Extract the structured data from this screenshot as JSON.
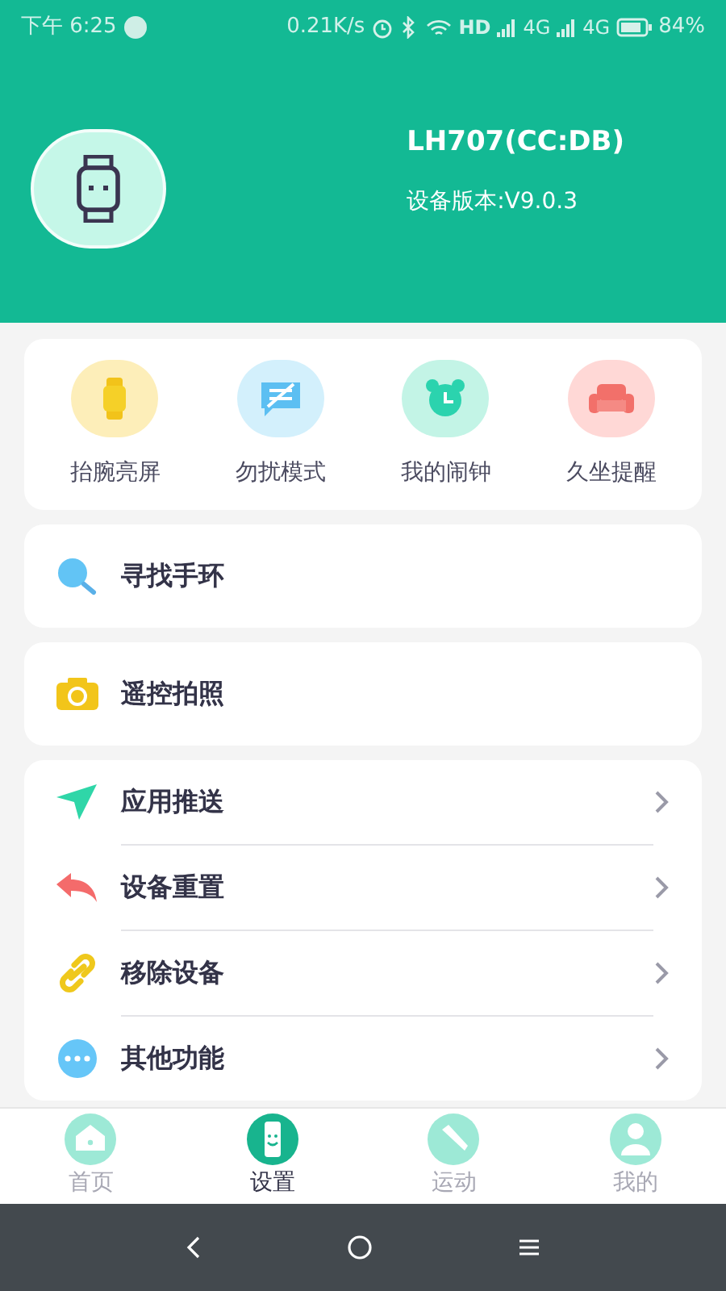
{
  "status_bar": {
    "time": "下午 6:25",
    "speed": "0.21K/s",
    "hd": "HD",
    "network_1": "4G",
    "network_2": "4G",
    "battery": "84%"
  },
  "device": {
    "name": "LH707(CC:DB)",
    "version": "设备版本:V9.0.3"
  },
  "quick_actions": [
    {
      "kind": "wrist",
      "label": "抬腕亮屏"
    },
    {
      "kind": "dnd",
      "label": "勿扰模式"
    },
    {
      "kind": "alarm",
      "label": "我的闹钟"
    },
    {
      "kind": "sedentary",
      "label": "久坐提醒"
    }
  ],
  "single_cards": [
    {
      "kind": "find",
      "label": "寻找手环"
    },
    {
      "kind": "camera",
      "label": "遥控拍照"
    }
  ],
  "menu": [
    {
      "kind": "push",
      "label": "应用推送"
    },
    {
      "kind": "reset",
      "label": "设备重置"
    },
    {
      "kind": "remove",
      "label": "移除设备"
    },
    {
      "kind": "more",
      "label": "其他功能"
    }
  ],
  "tabs": [
    {
      "kind": "home",
      "label": "首页",
      "selected": false
    },
    {
      "kind": "settings",
      "label": "设置",
      "selected": true
    },
    {
      "kind": "sport",
      "label": "运动",
      "selected": false
    },
    {
      "kind": "me",
      "label": "我的",
      "selected": false
    }
  ]
}
